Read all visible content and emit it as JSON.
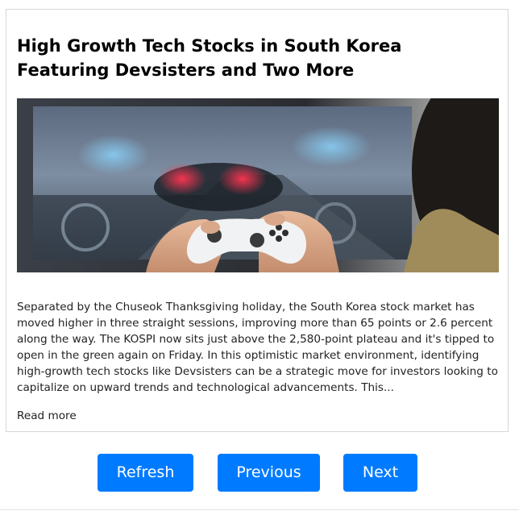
{
  "article": {
    "title": "High Growth Tech Stocks in South Korea Featuring Devsisters and Two More",
    "image_alt": "Person holding a game controller in front of a racing game on a monitor",
    "body": "Separated by the Chuseok Thanksgiving holiday, the South Korea stock market has moved higher in three straight sessions, improving more than 65 points or 2.6 percent along the way. The KOSPI now sits just above the 2,580-point plateau and it's tipped to open in the green again on Friday. In this optimistic market environment, identifying high-growth tech stocks like Devsisters can be a strategic move for investors looking to capitalize on upward trends and technological advancements. This...",
    "read_more_label": "Read more"
  },
  "controls": {
    "refresh_label": "Refresh",
    "previous_label": "Previous",
    "next_label": "Next"
  },
  "colors": {
    "button_bg": "#007bff",
    "button_text": "#ffffff",
    "card_border": "#d6d6d6"
  }
}
